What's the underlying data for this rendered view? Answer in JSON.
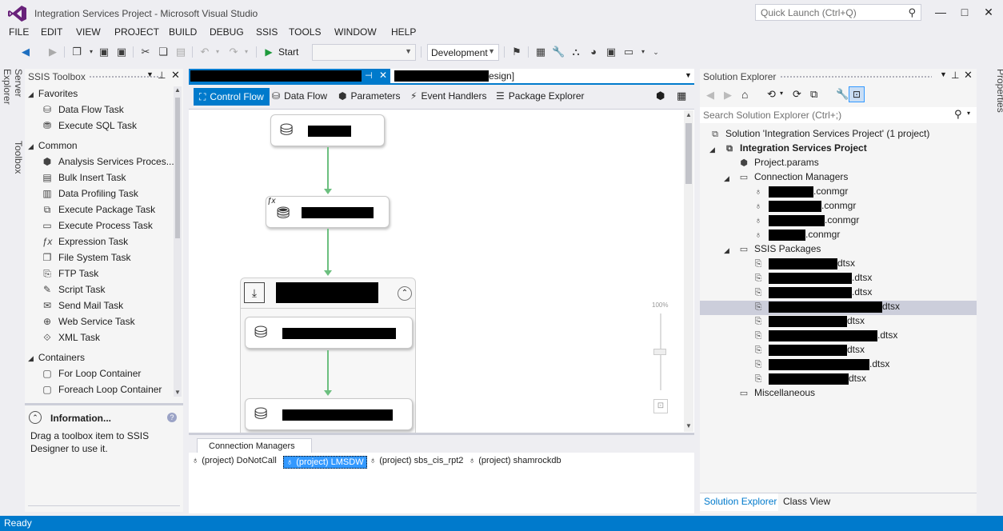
{
  "window": {
    "title": "Integration Services Project - Microsoft Visual Studio",
    "quick_launch_placeholder": "Quick Launch (Ctrl+Q)",
    "minimize": "—",
    "maximize": "□",
    "close": "✕"
  },
  "menu": [
    "FILE",
    "EDIT",
    "VIEW",
    "PROJECT",
    "BUILD",
    "DEBUG",
    "SSIS",
    "TOOLS",
    "WINDOW",
    "HELP"
  ],
  "toolbar": {
    "start_label": "Start",
    "config_value": "Development"
  },
  "side_tabs": {
    "server_explorer": "Server Explorer",
    "toolbox": "Toolbox",
    "properties": "Properties"
  },
  "toolbox": {
    "title": "SSIS Toolbox",
    "groups": {
      "favorites": "Favorites",
      "common": "Common",
      "containers": "Containers"
    },
    "favorites": [
      "Data Flow Task",
      "Execute SQL Task"
    ],
    "common": [
      "Analysis Services Proces...",
      "Bulk Insert Task",
      "Data Profiling Task",
      "Execute Package Task",
      "Execute Process Task",
      "Expression Task",
      "File System Task",
      "FTP Task",
      "Script Task",
      "Send Mail Task",
      "Web Service Task",
      "XML Task"
    ],
    "containers": [
      "For Loop Container",
      "Foreach Loop Container"
    ],
    "info_title": "Information...",
    "info_text_1": "Drag a toolbox item to SSIS",
    "info_text_2": "Designer to use it.",
    "info_help": "?"
  },
  "designer": {
    "doc_tab2_suffix": "esign]",
    "tabs": [
      "Control Flow",
      "Data Flow",
      "Parameters",
      "Event Handlers",
      "Package Explorer"
    ],
    "zoom_label": "100%",
    "conn_managers_tab": "Connection Managers",
    "connections": [
      "(project) DoNotCall",
      "(project) LMSDW",
      "(project) sbs_cis_rpt2",
      "(project) shamrockdb"
    ]
  },
  "solution_explorer": {
    "title": "Solution Explorer",
    "search_placeholder": "Search Solution Explorer (Ctrl+;)",
    "solution": "Solution 'Integration Services Project' (1 project)",
    "project": "Integration Services Project",
    "params": "Project.params",
    "conn_managers": "Connection Managers",
    "conn_items": [
      ".conmgr",
      ".conmgr",
      ".conmgr",
      ".conmgr"
    ],
    "ssis_packages": "SSIS Packages",
    "packages": [
      "dtsx",
      ".dtsx",
      ".dtsx",
      "dtsx",
      "dtsx",
      ".dtsx",
      "dtsx",
      ".dtsx",
      "dtsx"
    ],
    "misc": "Miscellaneous",
    "bottom_tabs": [
      "Solution Explorer",
      "Class View"
    ]
  },
  "status": {
    "text": "Ready"
  },
  "colors": {
    "accent": "#007acc",
    "connector": "#6cbf7f",
    "selected_row": "#cccedb"
  }
}
